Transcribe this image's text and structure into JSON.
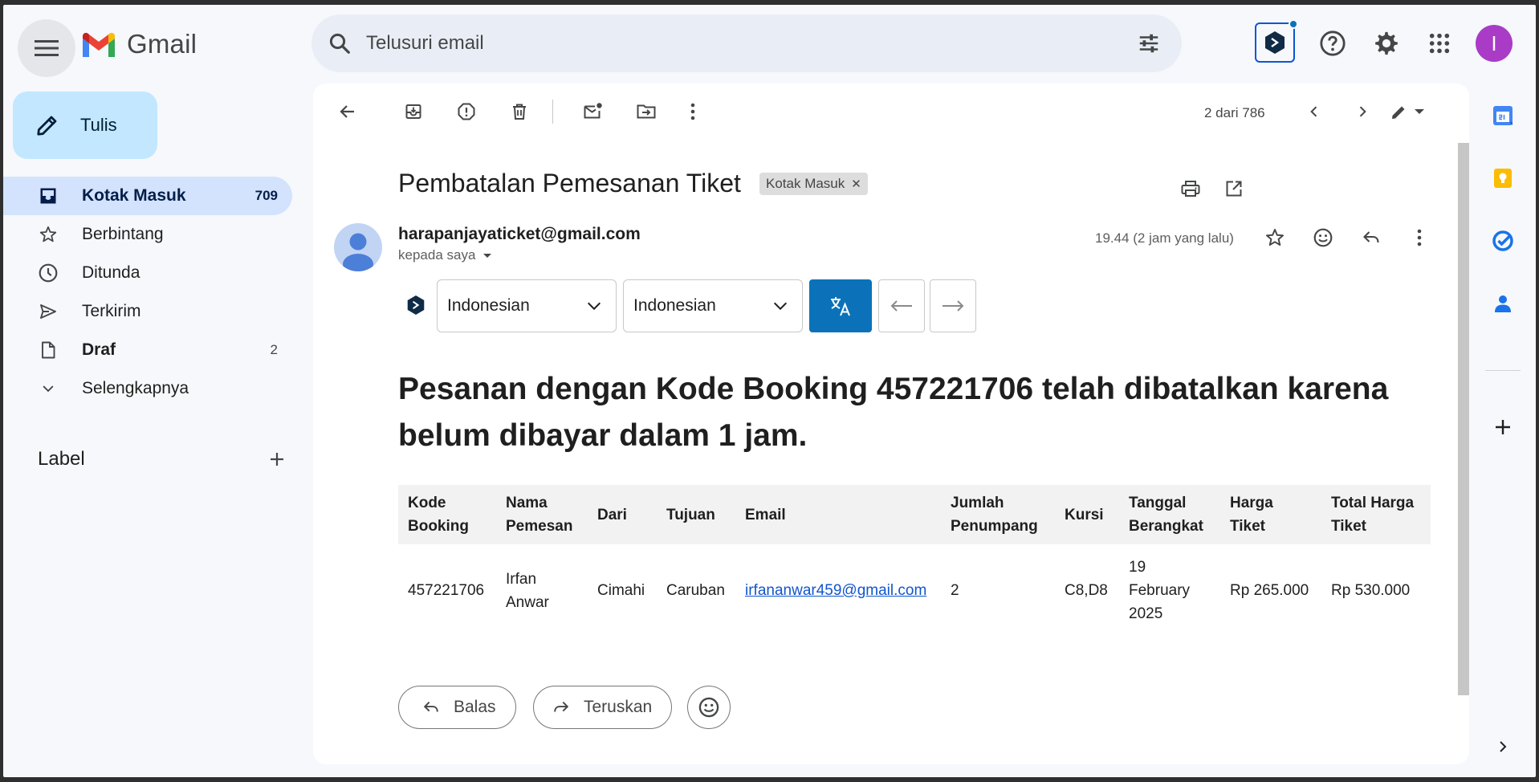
{
  "app": {
    "logo_text": "Gmail"
  },
  "search": {
    "placeholder": "Telusuri email"
  },
  "account": {
    "avatar_letter": "I",
    "avatar_color": "#a93bc7"
  },
  "compose": {
    "label": "Tulis"
  },
  "sidebar": {
    "items": [
      {
        "label": "Kotak Masuk",
        "count": "709"
      },
      {
        "label": "Berbintang",
        "count": ""
      },
      {
        "label": "Ditunda",
        "count": ""
      },
      {
        "label": "Terkirim",
        "count": ""
      },
      {
        "label": "Draf",
        "count": "2"
      },
      {
        "label": "Selengkapnya",
        "count": ""
      }
    ],
    "labels_heading": "Label"
  },
  "toolbar": {
    "pager": "2 dari 786"
  },
  "email": {
    "subject": "Pembatalan Pemesanan Tiket",
    "badge": "Kotak Masuk",
    "sender": "harapanjayaticket@gmail.com",
    "recipient": "kepada saya",
    "time": "19.44 (2 jam yang lalu)",
    "headline": "Pesanan dengan Kode Booking 457221706 telah dibatalkan karena belum dibayar dalam 1 jam.",
    "table": {
      "headers": [
        "Kode Booking",
        "Nama Pemesan",
        "Dari",
        "Tujuan",
        "Email",
        "Jumlah Penumpang",
        "Kursi",
        "Tanggal Berangkat",
        "Harga Tiket",
        "Total Harga Tiket"
      ],
      "rows": [
        [
          "457221706",
          "Irfan Anwar",
          "Cimahi",
          "Caruban",
          "irfananwar459@gmail.com",
          "2",
          "C8,D8",
          "19 February 2025",
          "Rp 265.000",
          "Rp 530.000"
        ]
      ]
    }
  },
  "translator": {
    "source_lang": "Indonesian",
    "target_lang": "Indonesian",
    "accent": "#0b72b9"
  },
  "actions": {
    "reply": "Balas",
    "forward": "Teruskan"
  },
  "colors": {
    "compose_bg": "#c2e7ff",
    "active_nav": "#d3e3fd",
    "link": "#1155cc"
  }
}
